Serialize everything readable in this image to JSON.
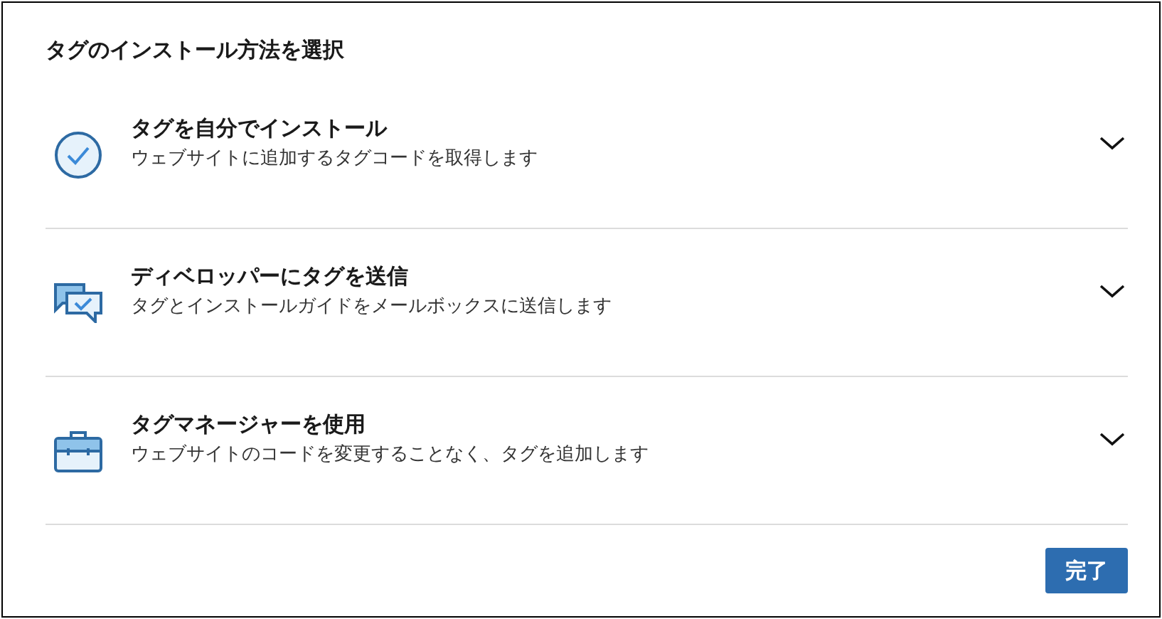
{
  "title": "タグのインストール方法を選択",
  "options": [
    {
      "kind": "check",
      "title": "タグを自分でインストール",
      "description": "ウェブサイトに追加するタグコードを取得します"
    },
    {
      "kind": "chat",
      "title": "ディベロッパーにタグを送信",
      "description": "タグとインストールガイドをメールボックスに送信します"
    },
    {
      "kind": "briefcase",
      "title": "タグマネージャーを使用",
      "description": "ウェブサイトのコードを変更することなく、タグを追加します"
    }
  ],
  "button": "完了"
}
